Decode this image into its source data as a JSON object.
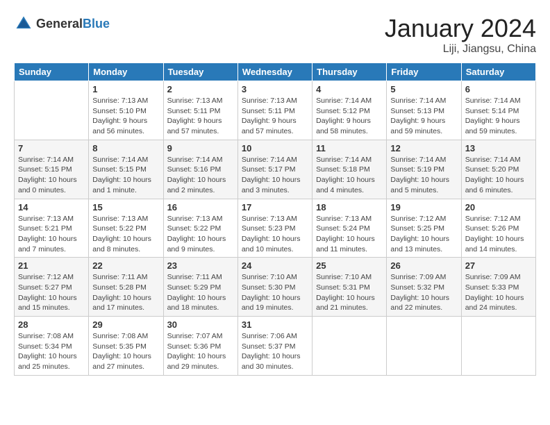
{
  "header": {
    "logo_general": "General",
    "logo_blue": "Blue",
    "month": "January 2024",
    "location": "Liji, Jiangsu, China"
  },
  "weekdays": [
    "Sunday",
    "Monday",
    "Tuesday",
    "Wednesday",
    "Thursday",
    "Friday",
    "Saturday"
  ],
  "weeks": [
    [
      {
        "day": "",
        "info": ""
      },
      {
        "day": "1",
        "info": "Sunrise: 7:13 AM\nSunset: 5:10 PM\nDaylight: 9 hours\nand 56 minutes."
      },
      {
        "day": "2",
        "info": "Sunrise: 7:13 AM\nSunset: 5:11 PM\nDaylight: 9 hours\nand 57 minutes."
      },
      {
        "day": "3",
        "info": "Sunrise: 7:13 AM\nSunset: 5:11 PM\nDaylight: 9 hours\nand 57 minutes."
      },
      {
        "day": "4",
        "info": "Sunrise: 7:14 AM\nSunset: 5:12 PM\nDaylight: 9 hours\nand 58 minutes."
      },
      {
        "day": "5",
        "info": "Sunrise: 7:14 AM\nSunset: 5:13 PM\nDaylight: 9 hours\nand 59 minutes."
      },
      {
        "day": "6",
        "info": "Sunrise: 7:14 AM\nSunset: 5:14 PM\nDaylight: 9 hours\nand 59 minutes."
      }
    ],
    [
      {
        "day": "7",
        "info": "Sunrise: 7:14 AM\nSunset: 5:15 PM\nDaylight: 10 hours\nand 0 minutes."
      },
      {
        "day": "8",
        "info": "Sunrise: 7:14 AM\nSunset: 5:15 PM\nDaylight: 10 hours\nand 1 minute."
      },
      {
        "day": "9",
        "info": "Sunrise: 7:14 AM\nSunset: 5:16 PM\nDaylight: 10 hours\nand 2 minutes."
      },
      {
        "day": "10",
        "info": "Sunrise: 7:14 AM\nSunset: 5:17 PM\nDaylight: 10 hours\nand 3 minutes."
      },
      {
        "day": "11",
        "info": "Sunrise: 7:14 AM\nSunset: 5:18 PM\nDaylight: 10 hours\nand 4 minutes."
      },
      {
        "day": "12",
        "info": "Sunrise: 7:14 AM\nSunset: 5:19 PM\nDaylight: 10 hours\nand 5 minutes."
      },
      {
        "day": "13",
        "info": "Sunrise: 7:14 AM\nSunset: 5:20 PM\nDaylight: 10 hours\nand 6 minutes."
      }
    ],
    [
      {
        "day": "14",
        "info": "Sunrise: 7:13 AM\nSunset: 5:21 PM\nDaylight: 10 hours\nand 7 minutes."
      },
      {
        "day": "15",
        "info": "Sunrise: 7:13 AM\nSunset: 5:22 PM\nDaylight: 10 hours\nand 8 minutes."
      },
      {
        "day": "16",
        "info": "Sunrise: 7:13 AM\nSunset: 5:22 PM\nDaylight: 10 hours\nand 9 minutes."
      },
      {
        "day": "17",
        "info": "Sunrise: 7:13 AM\nSunset: 5:23 PM\nDaylight: 10 hours\nand 10 minutes."
      },
      {
        "day": "18",
        "info": "Sunrise: 7:13 AM\nSunset: 5:24 PM\nDaylight: 10 hours\nand 11 minutes."
      },
      {
        "day": "19",
        "info": "Sunrise: 7:12 AM\nSunset: 5:25 PM\nDaylight: 10 hours\nand 13 minutes."
      },
      {
        "day": "20",
        "info": "Sunrise: 7:12 AM\nSunset: 5:26 PM\nDaylight: 10 hours\nand 14 minutes."
      }
    ],
    [
      {
        "day": "21",
        "info": "Sunrise: 7:12 AM\nSunset: 5:27 PM\nDaylight: 10 hours\nand 15 minutes."
      },
      {
        "day": "22",
        "info": "Sunrise: 7:11 AM\nSunset: 5:28 PM\nDaylight: 10 hours\nand 17 minutes."
      },
      {
        "day": "23",
        "info": "Sunrise: 7:11 AM\nSunset: 5:29 PM\nDaylight: 10 hours\nand 18 minutes."
      },
      {
        "day": "24",
        "info": "Sunrise: 7:10 AM\nSunset: 5:30 PM\nDaylight: 10 hours\nand 19 minutes."
      },
      {
        "day": "25",
        "info": "Sunrise: 7:10 AM\nSunset: 5:31 PM\nDaylight: 10 hours\nand 21 minutes."
      },
      {
        "day": "26",
        "info": "Sunrise: 7:09 AM\nSunset: 5:32 PM\nDaylight: 10 hours\nand 22 minutes."
      },
      {
        "day": "27",
        "info": "Sunrise: 7:09 AM\nSunset: 5:33 PM\nDaylight: 10 hours\nand 24 minutes."
      }
    ],
    [
      {
        "day": "28",
        "info": "Sunrise: 7:08 AM\nSunset: 5:34 PM\nDaylight: 10 hours\nand 25 minutes."
      },
      {
        "day": "29",
        "info": "Sunrise: 7:08 AM\nSunset: 5:35 PM\nDaylight: 10 hours\nand 27 minutes."
      },
      {
        "day": "30",
        "info": "Sunrise: 7:07 AM\nSunset: 5:36 PM\nDaylight: 10 hours\nand 29 minutes."
      },
      {
        "day": "31",
        "info": "Sunrise: 7:06 AM\nSunset: 5:37 PM\nDaylight: 10 hours\nand 30 minutes."
      },
      {
        "day": "",
        "info": ""
      },
      {
        "day": "",
        "info": ""
      },
      {
        "day": "",
        "info": ""
      }
    ]
  ]
}
